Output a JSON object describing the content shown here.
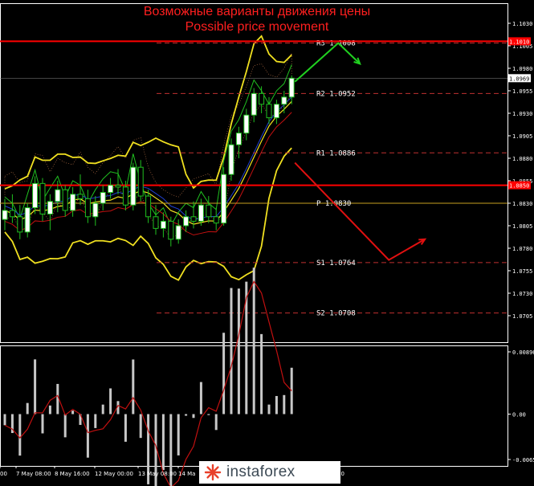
{
  "chart_data": {
    "type": "candlestick",
    "title": "Возможные варианты движения цены",
    "subtitle": "Possible price movement",
    "price_axis": {
      "ticks": [
        "1.1030",
        "1.1005",
        "1.0980",
        "1.0955",
        "1.0930",
        "1.0905",
        "1.0880",
        "1.0855",
        "1.0830",
        "1.0805",
        "1.0780",
        "1.0755",
        "1.0730",
        "1.0705"
      ],
      "current_price": "1.0969",
      "red_line_upper": "1.1010",
      "red_line_lower": "1.0850"
    },
    "pivot_levels": [
      {
        "name": "R3",
        "value": 1.1008,
        "label": "R3  1.1008"
      },
      {
        "name": "R2",
        "value": 1.0952,
        "label": "R2  1.0952"
      },
      {
        "name": "R1",
        "value": 1.0886,
        "label": "R1  1.0886"
      },
      {
        "name": "P",
        "value": 1.083,
        "label": "P  1.0830"
      },
      {
        "name": "S1",
        "value": 1.0764,
        "label": "S1  1.0764"
      },
      {
        "name": "S2",
        "value": 1.0708,
        "label": "S2  1.0708"
      }
    ],
    "macd_axis": {
      "ticks": [
        "0.00896",
        "0.00",
        "-0.00653"
      ]
    },
    "time_axis": {
      "labels": [
        "00",
        "7 May 08:00",
        "8 May 16:00",
        "12 May 00:00",
        "13 May 08:00",
        "14 Ma",
        "00"
      ]
    },
    "candles": [
      [
        1.0812,
        1.0835,
        1.08,
        1.0822
      ],
      [
        1.0822,
        1.084,
        1.0808,
        1.0815
      ],
      [
        1.0815,
        1.0828,
        1.079,
        1.0798
      ],
      [
        1.0798,
        1.083,
        1.0792,
        1.0825
      ],
      [
        1.0825,
        1.086,
        1.0818,
        1.0852
      ],
      [
        1.0852,
        1.0858,
        1.081,
        1.0818
      ],
      [
        1.0818,
        1.084,
        1.08,
        1.0832
      ],
      [
        1.0832,
        1.0855,
        1.082,
        1.0845
      ],
      [
        1.0845,
        1.085,
        1.0815,
        1.0822
      ],
      [
        1.0822,
        1.0848,
        1.0815,
        1.084
      ],
      [
        1.084,
        1.0862,
        1.0828,
        1.0835
      ],
      [
        1.0835,
        1.0845,
        1.0808,
        1.0815
      ],
      [
        1.0815,
        1.0838,
        1.0805,
        1.083
      ],
      [
        1.083,
        1.085,
        1.0822,
        1.0842
      ],
      [
        1.0842,
        1.0858,
        1.0835,
        1.085
      ],
      [
        1.085,
        1.0868,
        1.084,
        1.0848
      ],
      [
        1.0848,
        1.0855,
        1.0822,
        1.0828
      ],
      [
        1.0828,
        1.0875,
        1.0822,
        1.087
      ],
      [
        1.087,
        1.0878,
        1.0832,
        1.0838
      ],
      [
        1.0838,
        1.0845,
        1.0808,
        1.0815
      ],
      [
        1.0815,
        1.0828,
        1.0795,
        1.0802
      ],
      [
        1.0802,
        1.082,
        1.0792,
        1.081
      ],
      [
        1.081,
        1.0815,
        1.0782,
        1.079
      ],
      [
        1.079,
        1.0812,
        1.0785,
        1.0805
      ],
      [
        1.0805,
        1.0822,
        1.0798,
        1.0815
      ],
      [
        1.0815,
        1.0832,
        1.0802,
        1.081
      ],
      [
        1.081,
        1.0835,
        1.0805,
        1.0828
      ],
      [
        1.0828,
        1.0838,
        1.0808,
        1.0815
      ],
      [
        1.0815,
        1.0825,
        1.08,
        1.0808
      ],
      [
        1.0808,
        1.087,
        1.0805,
        1.0862
      ],
      [
        1.0862,
        1.0902,
        1.0855,
        1.0895
      ],
      [
        1.0895,
        1.0915,
        1.088,
        1.0908
      ],
      [
        1.0908,
        1.0935,
        1.09,
        1.0928
      ],
      [
        1.0928,
        1.0958,
        1.092,
        1.0952
      ],
      [
        1.0952,
        1.096,
        1.093,
        1.094
      ],
      [
        1.094,
        1.0948,
        1.0918,
        1.0925
      ],
      [
        1.0925,
        1.0945,
        1.0918,
        1.094
      ],
      [
        1.094,
        1.0955,
        1.093,
        1.0948
      ],
      [
        1.0948,
        1.0972,
        1.094,
        1.0969
      ]
    ],
    "forecast_paths": [
      {
        "color": "#20d020",
        "points": [
          [
            1.0965,
            0
          ],
          [
            1.1008,
            6
          ],
          [
            1.0985,
            9
          ]
        ]
      },
      {
        "color": "#e01010",
        "points": [
          [
            1.0875,
            0
          ],
          [
            1.0767,
            13
          ],
          [
            1.079,
            18
          ]
        ]
      }
    ],
    "colors": {
      "background": "#000000",
      "up": "#ffffff",
      "down": "#000000",
      "candle_border": "#20c020",
      "bollinger": "#f0e020",
      "level_line": "#ff0000",
      "pivot_dash": "#c03030",
      "pivot_P": "#c8a020",
      "macd_hist": "#c8c8c8",
      "macd_signal": "#c01010"
    }
  },
  "logo": {
    "text": "instaforex"
  }
}
